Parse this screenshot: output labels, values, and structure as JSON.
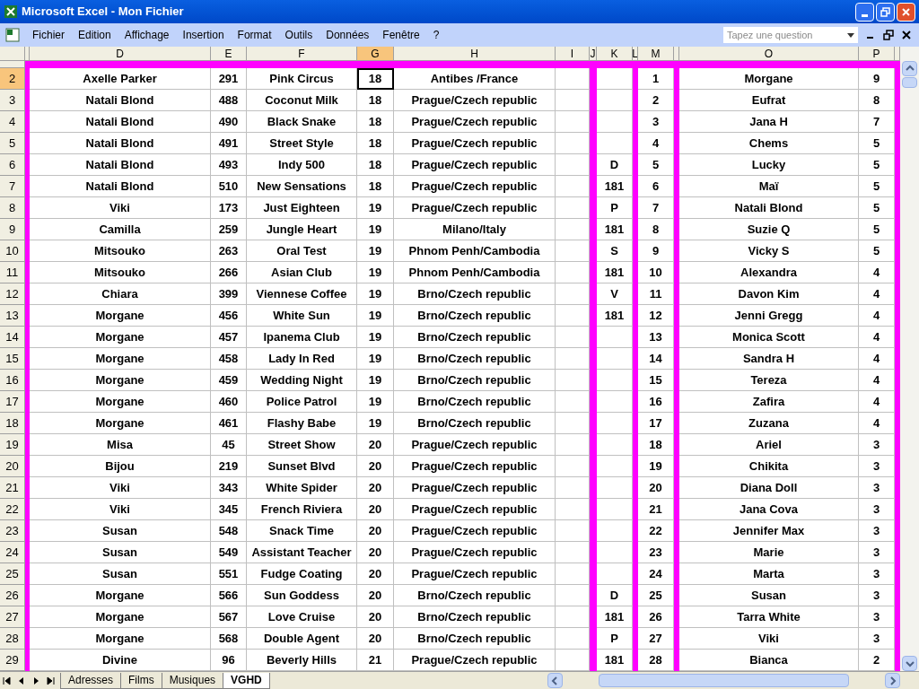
{
  "window": {
    "title": "Microsoft Excel - Mon Fichier"
  },
  "menu": [
    "Fichier",
    "Edition",
    "Affichage",
    "Insertion",
    "Format",
    "Outils",
    "Données",
    "Fenêtre",
    "?"
  ],
  "help_search": {
    "placeholder": "Tapez une question"
  },
  "columns": [
    {
      "kind": "band",
      "selected": false
    },
    {
      "kind": "data",
      "label": "D",
      "selected": false
    },
    {
      "kind": "data",
      "label": "E",
      "selected": false
    },
    {
      "kind": "data",
      "label": "F",
      "selected": false
    },
    {
      "kind": "data",
      "label": "G",
      "selected": true
    },
    {
      "kind": "data",
      "label": "H",
      "selected": false
    },
    {
      "kind": "data",
      "label": "I",
      "selected": false
    },
    {
      "kind": "band",
      "label": "J",
      "selected": false
    },
    {
      "kind": "data",
      "label": "K",
      "selected": false
    },
    {
      "kind": "band",
      "label": "L",
      "selected": false
    },
    {
      "kind": "data",
      "label": "M",
      "selected": false
    },
    {
      "kind": "band",
      "selected": false
    },
    {
      "kind": "data",
      "label": "O",
      "selected": false
    },
    {
      "kind": "data",
      "label": "P",
      "selected": false
    },
    {
      "kind": "band",
      "selected": false
    }
  ],
  "rows": [
    {
      "number": "2",
      "selected": true,
      "cells": [
        "Axelle Parker",
        "291",
        "Pink Circus",
        "18",
        "Antibes /France",
        null,
        null,
        "1",
        "Morgane",
        "9"
      ]
    },
    {
      "number": "3",
      "selected": false,
      "cells": [
        "Natali Blond",
        "488",
        "Coconut Milk",
        "18",
        "Prague/Czech republic",
        null,
        null,
        "2",
        "Eufrat",
        "8"
      ]
    },
    {
      "number": "4",
      "selected": false,
      "cells": [
        "Natali Blond",
        "490",
        "Black Snake",
        "18",
        "Prague/Czech republic",
        null,
        null,
        "3",
        "Jana H",
        "7"
      ]
    },
    {
      "number": "5",
      "selected": false,
      "cells": [
        "Natali Blond",
        "491",
        "Street Style",
        "18",
        "Prague/Czech republic",
        null,
        null,
        "4",
        "Chems",
        "5"
      ]
    },
    {
      "number": "6",
      "selected": false,
      "cells": [
        "Natali Blond",
        "493",
        "Indy 500",
        "18",
        "Prague/Czech republic",
        null,
        "D",
        "5",
        "Lucky",
        "5"
      ]
    },
    {
      "number": "7",
      "selected": false,
      "cells": [
        "Natali Blond",
        "510",
        "New Sensations",
        "18",
        "Prague/Czech republic",
        null,
        "181",
        "6",
        "Maï",
        "5"
      ]
    },
    {
      "number": "8",
      "selected": false,
      "cells": [
        "Viki",
        "173",
        "Just Eighteen",
        "19",
        "Prague/Czech republic",
        null,
        "P",
        "7",
        "Natali Blond",
        "5"
      ]
    },
    {
      "number": "9",
      "selected": false,
      "cells": [
        "Camilla",
        "259",
        "Jungle Heart",
        "19",
        "Milano/Italy",
        null,
        "181",
        "8",
        "Suzie Q",
        "5"
      ]
    },
    {
      "number": "10",
      "selected": false,
      "cells": [
        "Mitsouko",
        "263",
        "Oral Test",
        "19",
        "Phnom Penh/Cambodia",
        null,
        "S",
        "9",
        "Vicky S",
        "5"
      ]
    },
    {
      "number": "11",
      "selected": false,
      "cells": [
        "Mitsouko",
        "266",
        "Asian Club",
        "19",
        "Phnom Penh/Cambodia",
        null,
        "181",
        "10",
        "Alexandra",
        "4"
      ]
    },
    {
      "number": "12",
      "selected": false,
      "cells": [
        "Chiara",
        "399",
        "Viennese Coffee",
        "19",
        "Brno/Czech republic",
        null,
        "V",
        "11",
        "Davon Kim",
        "4"
      ]
    },
    {
      "number": "13",
      "selected": false,
      "cells": [
        "Morgane",
        "456",
        "White Sun",
        "19",
        "Brno/Czech republic",
        null,
        "181",
        "12",
        "Jenni Gregg",
        "4"
      ]
    },
    {
      "number": "14",
      "selected": false,
      "cells": [
        "Morgane",
        "457",
        "Ipanema Club",
        "19",
        "Brno/Czech republic",
        null,
        null,
        "13",
        "Monica Scott",
        "4"
      ]
    },
    {
      "number": "15",
      "selected": false,
      "cells": [
        "Morgane",
        "458",
        "Lady In Red",
        "19",
        "Brno/Czech republic",
        null,
        null,
        "14",
        "Sandra H",
        "4"
      ]
    },
    {
      "number": "16",
      "selected": false,
      "cells": [
        "Morgane",
        "459",
        "Wedding Night",
        "19",
        "Brno/Czech republic",
        null,
        null,
        "15",
        "Tereza",
        "4"
      ]
    },
    {
      "number": "17",
      "selected": false,
      "cells": [
        "Morgane",
        "460",
        "Police Patrol",
        "19",
        "Brno/Czech republic",
        null,
        null,
        "16",
        "Zafira",
        "4"
      ]
    },
    {
      "number": "18",
      "selected": false,
      "cells": [
        "Morgane",
        "461",
        "Flashy Babe",
        "19",
        "Brno/Czech republic",
        null,
        null,
        "17",
        "Zuzana",
        "4"
      ]
    },
    {
      "number": "19",
      "selected": false,
      "cells": [
        "Misa",
        "45",
        "Street Show",
        "20",
        "Prague/Czech republic",
        null,
        null,
        "18",
        "Ariel",
        "3"
      ]
    },
    {
      "number": "20",
      "selected": false,
      "cells": [
        "Bijou",
        "219",
        "Sunset Blvd",
        "20",
        "Prague/Czech republic",
        null,
        null,
        "19",
        "Chikita",
        "3"
      ]
    },
    {
      "number": "21",
      "selected": false,
      "cells": [
        "Viki",
        "343",
        "White Spider",
        "20",
        "Prague/Czech republic",
        null,
        null,
        "20",
        "Diana Doll",
        "3"
      ]
    },
    {
      "number": "22",
      "selected": false,
      "cells": [
        "Viki",
        "345",
        "French Riviera",
        "20",
        "Prague/Czech republic",
        null,
        null,
        "21",
        "Jana Cova",
        "3"
      ]
    },
    {
      "number": "23",
      "selected": false,
      "cells": [
        "Susan",
        "548",
        "Snack Time",
        "20",
        "Prague/Czech republic",
        null,
        null,
        "22",
        "Jennifer Max",
        "3"
      ]
    },
    {
      "number": "24",
      "selected": false,
      "cells": [
        "Susan",
        "549",
        "Assistant Teacher",
        "20",
        "Prague/Czech republic",
        null,
        null,
        "23",
        "Marie",
        "3"
      ]
    },
    {
      "number": "25",
      "selected": false,
      "cells": [
        "Susan",
        "551",
        "Fudge Coating",
        "20",
        "Prague/Czech republic",
        null,
        null,
        "24",
        "Marta",
        "3"
      ]
    },
    {
      "number": "26",
      "selected": false,
      "cells": [
        "Morgane",
        "566",
        "Sun Goddess",
        "20",
        "Brno/Czech republic",
        null,
        "D",
        "25",
        "Susan",
        "3"
      ]
    },
    {
      "number": "27",
      "selected": false,
      "cells": [
        "Morgane",
        "567",
        "Love Cruise",
        "20",
        "Brno/Czech republic",
        null,
        "181",
        "26",
        "Tarra White",
        "3"
      ]
    },
    {
      "number": "28",
      "selected": false,
      "cells": [
        "Morgane",
        "568",
        "Double Agent",
        "20",
        "Brno/Czech republic",
        null,
        "P",
        "27",
        "Viki",
        "3"
      ]
    },
    {
      "number": "29",
      "selected": false,
      "cells": [
        "Divine",
        "96",
        "Beverly Hills",
        "21",
        "Prague/Czech republic",
        null,
        "181",
        "28",
        "Bianca",
        "2"
      ]
    }
  ],
  "sheet_tabs": [
    {
      "label": "Adresses",
      "selected": false
    },
    {
      "label": "Films",
      "selected": false
    },
    {
      "label": "Musiques",
      "selected": false
    },
    {
      "label": "VGHD",
      "selected": true
    }
  ]
}
